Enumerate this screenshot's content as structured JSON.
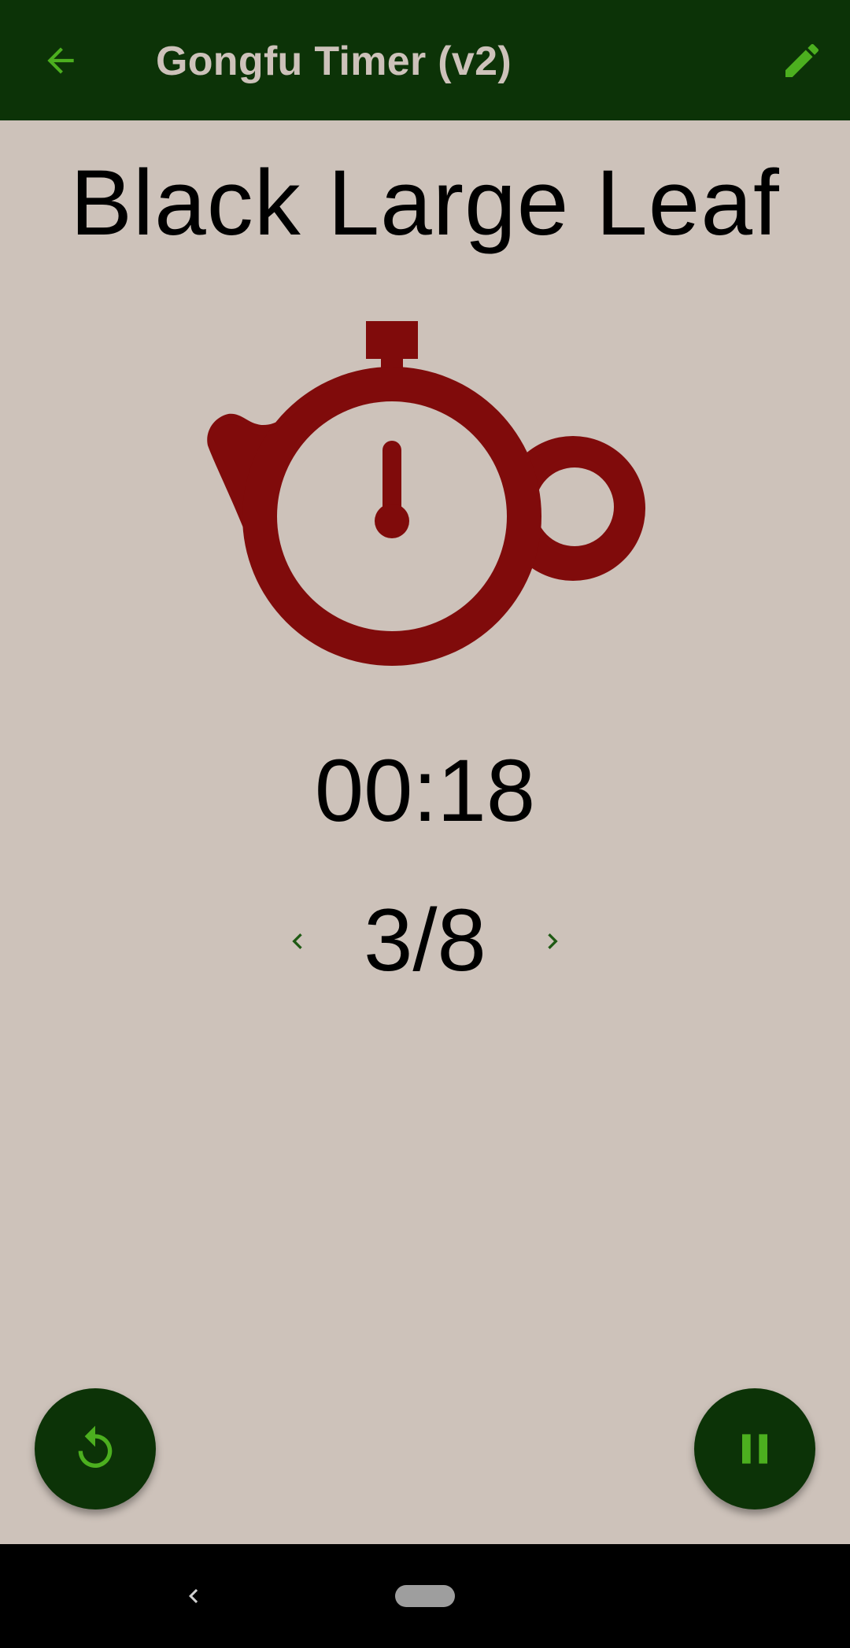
{
  "app_bar": {
    "title": "Gongfu Timer (v2)",
    "back_icon": "arrow-back-icon",
    "edit_icon": "pencil-edit-icon"
  },
  "tea": {
    "name": "Black Large Leaf"
  },
  "timer": {
    "time": "00:18",
    "illustration_icon": "teapot-stopwatch-icon"
  },
  "infusion": {
    "label": "3/8",
    "prev_icon": "chevron-left-icon",
    "next_icon": "chevron-right-icon"
  },
  "actions": {
    "reset_icon": "restart-icon",
    "pause_icon": "pause-icon"
  },
  "colors": {
    "appbar": "#0c3307",
    "accent": "#4caf1f",
    "background": "#cdc2ba",
    "teapot": "#800b0b"
  }
}
